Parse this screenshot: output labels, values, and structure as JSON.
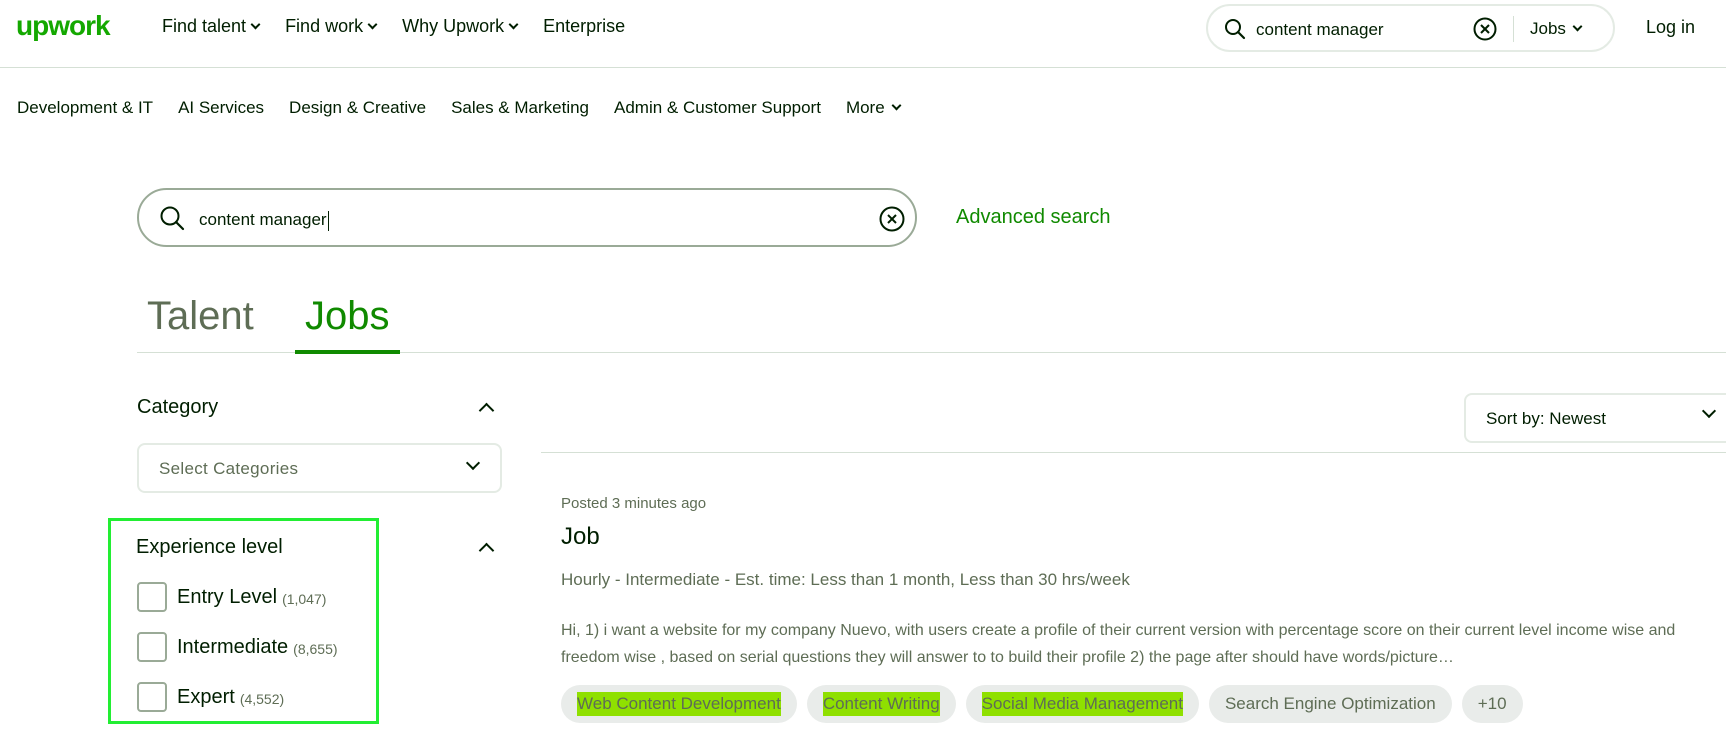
{
  "header": {
    "logo": "upwork",
    "nav": [
      "Find talent",
      "Find work",
      "Why Upwork",
      "Enterprise"
    ],
    "search_value": "content manager",
    "search_type": "Jobs",
    "login": "Log in"
  },
  "categories": [
    "Development & IT",
    "AI Services",
    "Design & Creative",
    "Sales & Marketing",
    "Admin & Customer Support",
    "More"
  ],
  "search": {
    "value": "content manager",
    "advanced": "Advanced search"
  },
  "tabs": [
    "Talent",
    "Jobs"
  ],
  "filters": {
    "category_title": "Category",
    "category_placeholder": "Select Categories",
    "experience_title": "Experience level",
    "experience": [
      {
        "label": "Entry Level",
        "count": "(1,047)"
      },
      {
        "label": "Intermediate",
        "count": "(8,655)"
      },
      {
        "label": "Expert",
        "count": "(4,552)"
      }
    ]
  },
  "sort": {
    "label": "Sort by: Newest"
  },
  "job": {
    "posted": "Posted 3 minutes ago",
    "title": "Job",
    "meta": "Hourly - Intermediate - Est. time: Less than 1 month, Less than 30 hrs/week",
    "description": "Hi, 1) i want a website for my company Nuevo, with users create a profile of their current version with percentage score on their current level income wise and freedom wise , based on serial questions they will answer to to build their profile 2) the page after should have words/picture…",
    "tags": [
      "Web Content Development",
      "Content Writing",
      "Social Media Management",
      "Search Engine Optimization",
      "+10"
    ]
  }
}
